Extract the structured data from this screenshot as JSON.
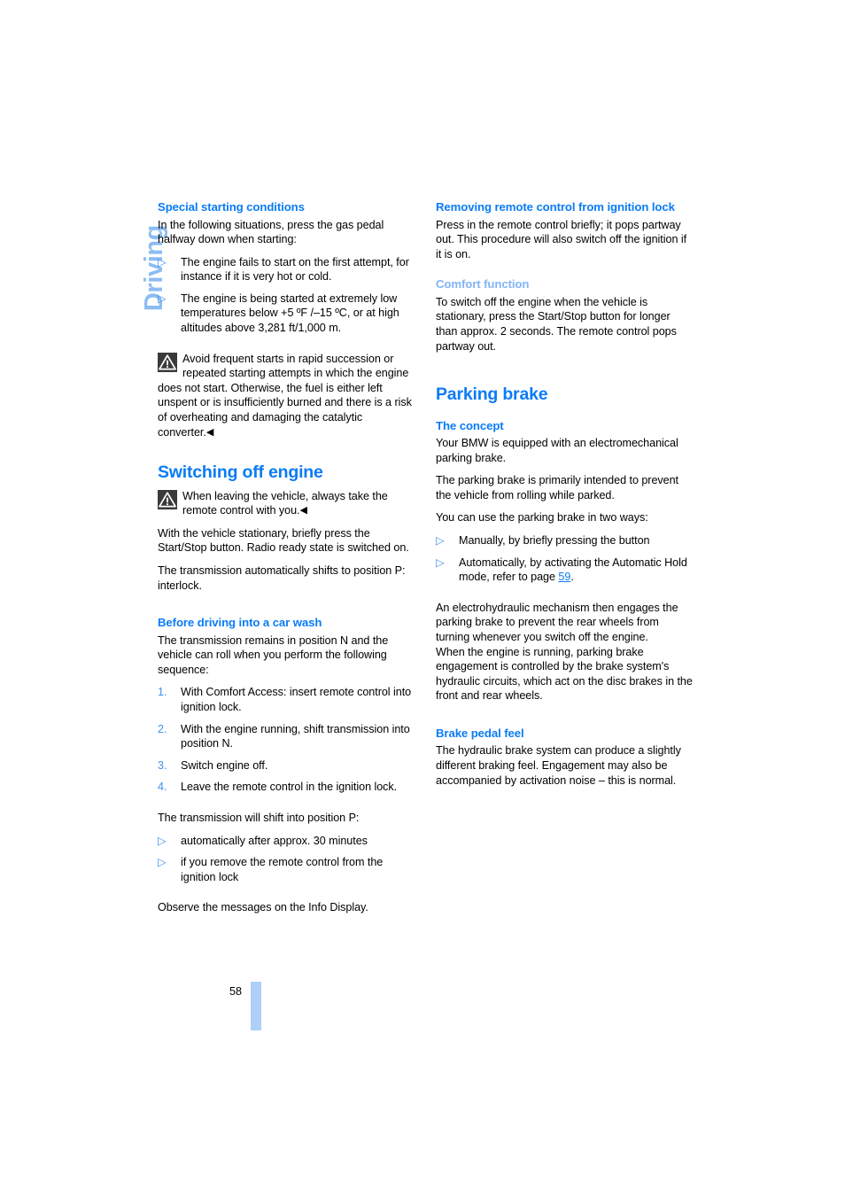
{
  "chapter_tab": "Driving",
  "folio": {
    "page_number": "58"
  },
  "left_column": {
    "h_special": "Special starting conditions",
    "p_special_intro": "In the following situations, press the gas pedal halfway down when starting:",
    "bullets_special": [
      "The engine fails to start on the first attempt, for instance if it is very hot or cold.",
      "The engine is being started at extremely low temperatures below +5 ºF /–15 ºC, or at high altitudes above 3,281 ft/1,000 m."
    ],
    "warn_catalytic": "Avoid frequent starts in rapid succession or repeated starting attempts in which the engine does not start. Otherwise, the fuel is either left unspent or is insufficiently burned and there is a risk of overheating and damaging the catalytic converter.",
    "h_switching_off": "Switching off engine",
    "warn_remote": "When leaving the vehicle, always take the remote control with you.",
    "p_stationary": "With the vehicle stationary, briefly press the Start/Stop button. Radio ready state is switched on.",
    "p_transmission": "The transmission automatically shifts to position P: interlock.",
    "h_car_wash": "Before driving into a car wash",
    "p_car_wash_intro": "The transmission remains in position N and the vehicle can roll when you perform the following sequence:",
    "steps_car_wash": [
      {
        "num": "1.",
        "text": "With Comfort Access: insert remote control into ignition lock."
      },
      {
        "num": "2.",
        "text": "With the engine running, shift transmission into position N."
      },
      {
        "num": "3.",
        "text": "Switch engine off."
      },
      {
        "num": "4.",
        "text": "Leave the remote control in the ignition lock."
      }
    ],
    "p_shift_p": "The transmission will shift into position P:",
    "bullets_shift_p": [
      "automatically after approx. 30 minutes",
      "if you remove the remote control from the ignition lock"
    ],
    "p_observe": "Observe the messages on the Info Display."
  },
  "right_column": {
    "h_removing": "Removing remote control from ignition lock",
    "p_removing": "Press in the remote control briefly; it pops partway out. This procedure will also switch off the ignition if it is on.",
    "h_comfort": "Comfort function",
    "p_comfort": "To switch off the engine when the vehicle is stationary, press the Start/Stop button for longer than approx. 2 seconds. The remote control pops partway out.",
    "h_parking_brake": "Parking brake",
    "h_concept": "The concept",
    "p_concept_1": "Your BMW is equipped with an electromechanical parking brake.",
    "p_concept_2": "The parking brake is primarily intended to prevent the vehicle from rolling while parked.",
    "p_concept_3": "You can use the parking brake in two ways:",
    "bullets_ways": [
      {
        "text_before": "Manually, by briefly pressing the button",
        "link": "",
        "text_after": ""
      },
      {
        "text_before": "Automatically, by activating the Automatic Hold mode, refer to page ",
        "link": "59",
        "text_after": "."
      }
    ],
    "p_electrohydraulic": "An electrohydraulic mechanism then engages the parking brake to prevent the rear wheels from turning whenever you switch off the engine.",
    "p_engine_running": "When the engine is running, parking brake engagement is controlled by the brake system's hydraulic circuits, which act on the disc brakes in the front and rear wheels.",
    "h_brake_pedal": "Brake pedal feel",
    "p_brake_pedal": "The hydraulic brake system can produce a slightly different braking feel. Engagement may also be accompanied by activation noise – this is normal."
  },
  "glyphs": {
    "bullet": "▷",
    "endmark": "◀",
    "warning_icon": "warning-triangle-icon"
  },
  "colors": {
    "heading_blue": "#0a7cf5",
    "subheading_light_blue": "#82b4f5",
    "chapter_tab_blue": "#8cbcf2",
    "folio_bar": "#aed0f8"
  }
}
